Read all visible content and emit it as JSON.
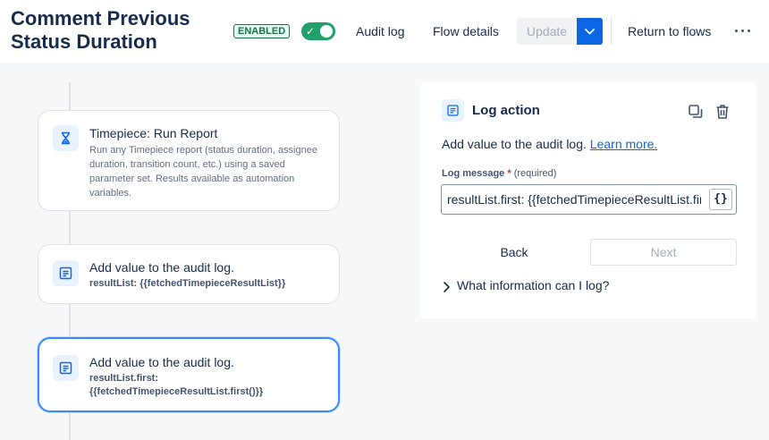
{
  "header": {
    "title": "Comment Previous Status Duration",
    "status_badge": "ENABLED",
    "audit_log": "Audit log",
    "flow_details": "Flow details",
    "update": "Update",
    "return_to_flows": "Return to flows",
    "more_icon": "ellipsis-icon"
  },
  "flow": {
    "cards": [
      {
        "icon": "hourglass-icon",
        "title": "Timepiece: Run Report",
        "description": "Run any Timepiece report (status duration, assignee duration, transition count, etc.) using a saved parameter set. Results available as automation variables."
      },
      {
        "icon": "log-icon",
        "title": "Add value to the audit log.",
        "code": "resultList: {{fetchedTimepieceResultList}}"
      },
      {
        "icon": "log-icon",
        "title": "Add value to the audit log.",
        "code": "resultList.first: {{fetchedTimepieceResultList.first()}}",
        "selected": true
      }
    ]
  },
  "panel": {
    "title": "Log action",
    "description": "Add value to the audit log.",
    "learn_more": "Learn more.",
    "field_label": "Log message",
    "required_marker": "*",
    "required_text": "(required)",
    "field_value": "resultList.first: {{fetchedTimepieceResultList.first()}}",
    "brace_button": "{}",
    "back": "Back",
    "next": "Next",
    "expander": "What information can I log?",
    "icons": [
      "log-icon",
      "duplicate-icon",
      "trash-icon"
    ]
  },
  "colors": {
    "accent": "#0c66e4",
    "toggle_on": "#22a06b",
    "selected_border": "#388bff"
  }
}
